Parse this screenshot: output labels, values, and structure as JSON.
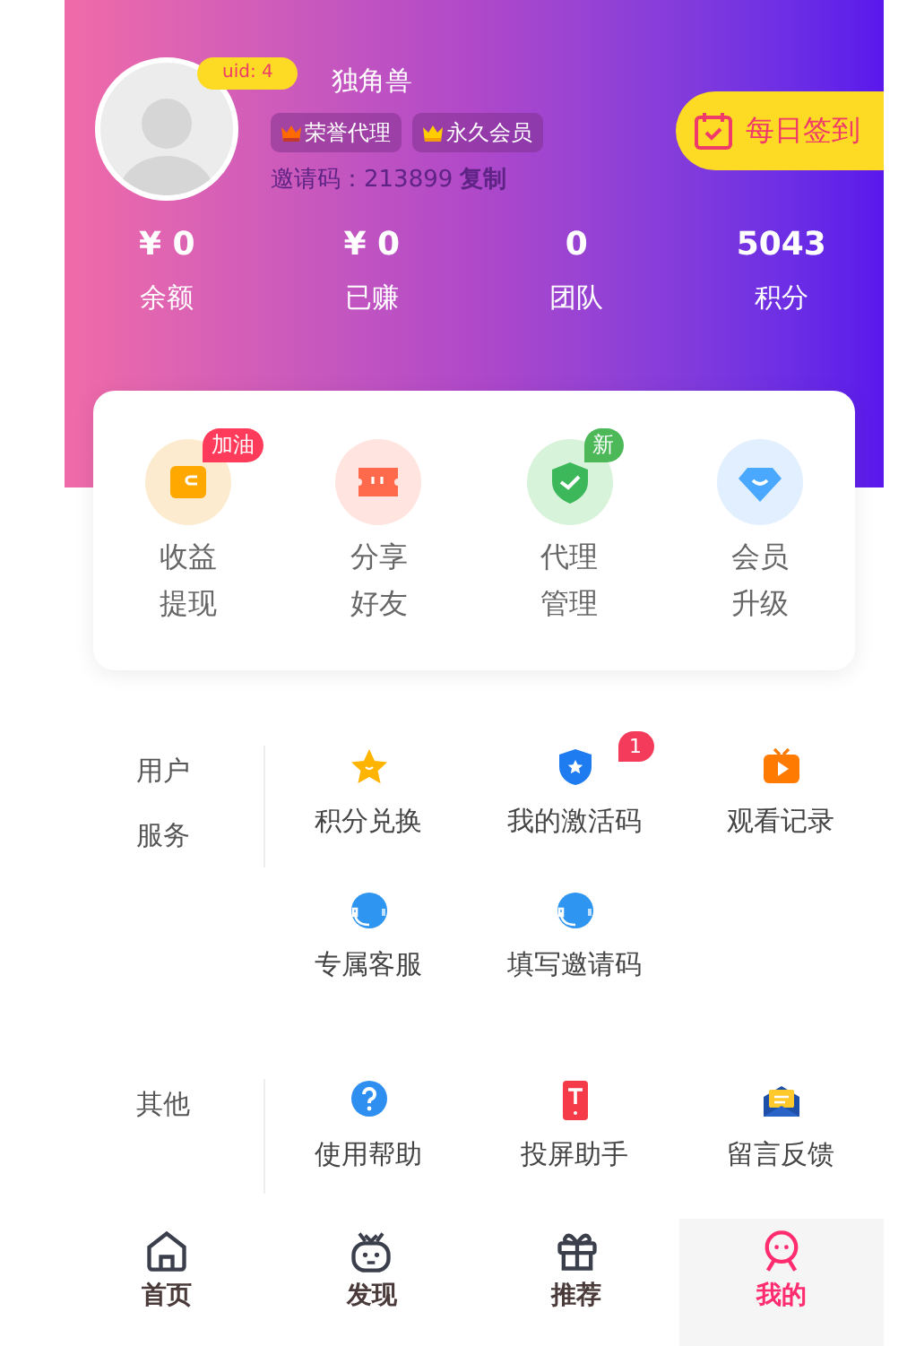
{
  "profile": {
    "uid": "uid: 4",
    "name": "独角兽",
    "tags": [
      {
        "label": "荣誉代理",
        "kind": "agent"
      },
      {
        "label": "永久会员",
        "kind": "member"
      }
    ],
    "invite_code": "邀请码：213899",
    "copy_link": "复制",
    "checkin_button": "每日签到"
  },
  "stats": [
    {
      "value": "¥ 0",
      "label": "余额"
    },
    {
      "value": "¥ 0",
      "label": "已赚"
    },
    {
      "value": "0",
      "label": "团队"
    },
    {
      "value": "5043",
      "label": "积分"
    }
  ],
  "quick_actions": [
    {
      "kind": "wallet",
      "label": "收益提现",
      "badge": {
        "text": "加油",
        "color": "#ff3b5c"
      }
    },
    {
      "kind": "ticket",
      "label": "分享好友"
    },
    {
      "kind": "shield",
      "label": "代理管理",
      "badge": {
        "text": "新",
        "color": "#4cb858"
      }
    },
    {
      "kind": "diamond",
      "label": "会员升级"
    }
  ],
  "sections": [
    {
      "title": "用户服务",
      "items": [
        {
          "kind": "star",
          "label": "积分兑换"
        },
        {
          "kind": "badge",
          "label": "我的激活码",
          "count": "1"
        },
        {
          "kind": "tv",
          "label": "观看记录"
        },
        {
          "kind": "headset",
          "label": "专属客服"
        },
        {
          "kind": "headset",
          "label": "填写邀请码"
        }
      ]
    },
    {
      "title": "其他",
      "items": [
        {
          "kind": "help",
          "label": "使用帮助"
        },
        {
          "kind": "phone",
          "label": "投屏助手"
        },
        {
          "kind": "mail",
          "label": "留言反馈"
        }
      ]
    }
  ],
  "nav": [
    {
      "kind": "home",
      "label": "首页",
      "selected": false
    },
    {
      "kind": "robot",
      "label": "发现",
      "selected": false
    },
    {
      "kind": "gift",
      "label": "推荐",
      "selected": false
    },
    {
      "kind": "person",
      "label": "我的",
      "selected": true
    }
  ]
}
